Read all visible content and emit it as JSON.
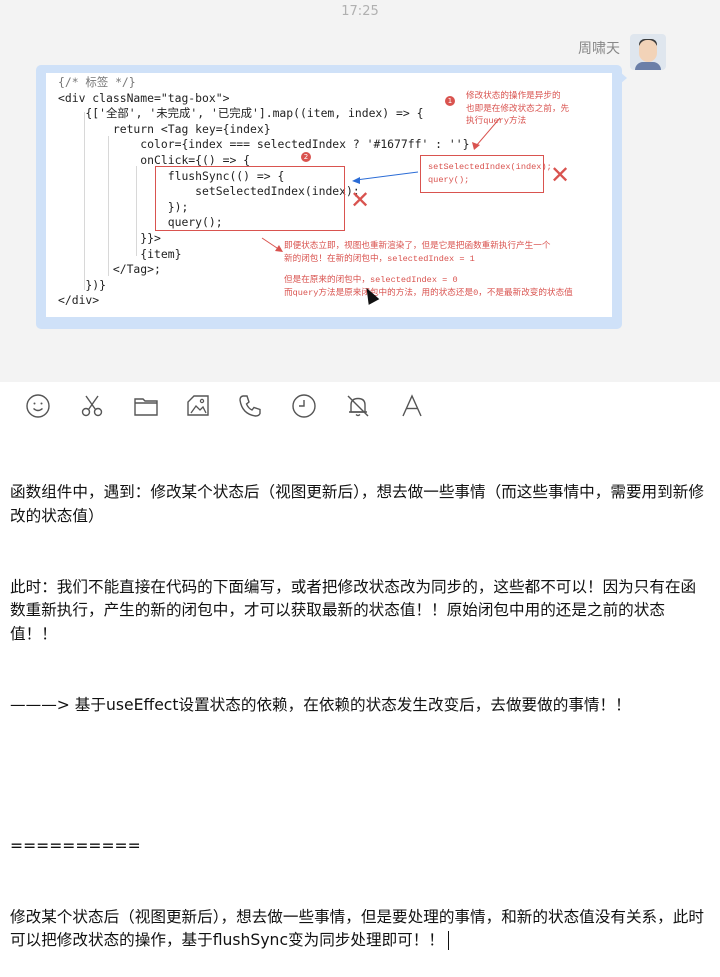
{
  "status_bar": {
    "time": "17:25"
  },
  "chat": {
    "sender_name": "周啸天",
    "image": {
      "code_lines": [
        "{/* 标签 */}",
        "<div className=\"tag-box\">",
        "    {['全部', '未完成', '已完成'].map((item, index) => {",
        "        return <Tag key={index}",
        "            color={index === selectedIndex ? '#1677ff' : ''}",
        "            onClick={() => {",
        "                flushSync(() => {",
        "                    setSelectedIndex(index);",
        "                });",
        "                query();",
        "            }}>",
        "            {item}",
        "        </Tag>;",
        "    })}",
        "</div>"
      ],
      "badge_1": "1",
      "badge_2": "2",
      "note_1": "修改状态的操作是异步的\n也即是在修改状态之前，先\n执行query方法",
      "note_box": "setSelectedIndex(index);\nquery();",
      "note_2": "即便状态立即，视图也重新渲染了，但是它是把函数重新执行产生一个\n新的闭包！在新的闭包中，selectedIndex = 1",
      "note_3": "但是在原来的闭包中，selectedIndex = 0\n而query方法是原来闭包中的方法，用的状态还是0，不是最新改变的状态值",
      "cross": "✕"
    }
  },
  "toolbar": {
    "items": [
      {
        "icon": "emoji-icon"
      },
      {
        "icon": "scissors-icon"
      },
      {
        "icon": "folder-icon"
      },
      {
        "icon": "screenshot-icon"
      },
      {
        "icon": "phone-icon"
      },
      {
        "icon": "clock-icon"
      },
      {
        "icon": "bell-off-icon"
      },
      {
        "icon": "text-format-icon"
      }
    ]
  },
  "editor": {
    "paragraphs": [
      "函数组件中，遇到：修改某个状态后（视图更新后），想去做一些事情（而这些事情中，需要用到新修改的状态值）",
      "此时：我们不能直接在代码的下面编写，或者把修改状态改为同步的，这些都不可以！因为只有在函数重新执行，产生的新的闭包中，才可以获取最新的状态值！！原始闭包中用的还是之前的状态值！！",
      "———> 基于useEffect设置状态的依赖，在依赖的状态发生改变后，去做要做的事情！！",
      "",
      "==========",
      "修改某个状态后（视图更新后），想去做一些事情，但是要处理的事情，和新的状态值没有关系，此时可以把修改状态的操作，基于flushSync变为同步处理即可！！"
    ]
  },
  "colors": {
    "accent_red": "#d9534f",
    "bubble": "#cfe1f8",
    "chat_bg": "#f3f3f3"
  }
}
